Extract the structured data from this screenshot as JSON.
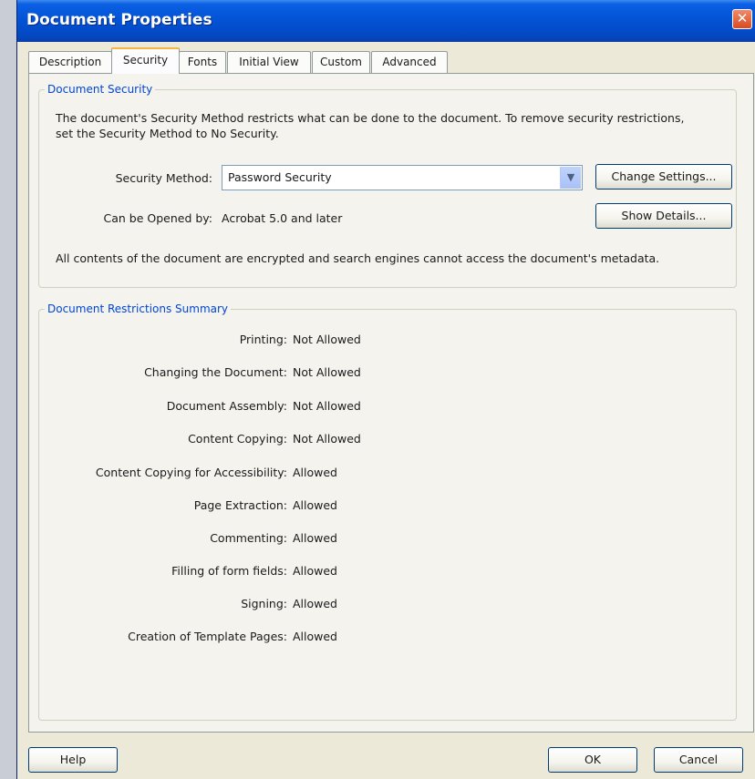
{
  "window": {
    "title": "Document Properties",
    "close_glyph": "✕"
  },
  "tabs": [
    "Description",
    "Security",
    "Fonts",
    "Initial View",
    "Custom",
    "Advanced"
  ],
  "active_tab": "Security",
  "document_security": {
    "group_title": "Document Security",
    "intro_text": "The document's Security Method restricts what can be done to the document. To remove security restrictions, set the Security Method to No Security.",
    "security_method_label": "Security Method:",
    "security_method_value": "Password Security",
    "change_settings_label": "Change Settings...",
    "opened_by_label": "Can be Opened by:",
    "opened_by_value": "Acrobat 5.0 and later",
    "show_details_label": "Show Details...",
    "encryption_note": "All contents of the document are encrypted and search engines cannot access the document's metadata."
  },
  "restrictions": {
    "group_title": "Document Restrictions Summary",
    "items": [
      {
        "label": "Printing:",
        "value": "Not Allowed"
      },
      {
        "label": "Changing the Document:",
        "value": "Not Allowed"
      },
      {
        "label": "Document Assembly:",
        "value": "Not Allowed"
      },
      {
        "label": "Content Copying:",
        "value": "Not Allowed"
      },
      {
        "label": "Content Copying for Accessibility:",
        "value": "Allowed"
      },
      {
        "label": "Page Extraction:",
        "value": "Allowed"
      },
      {
        "label": "Commenting:",
        "value": "Allowed"
      },
      {
        "label": "Filling of form fields:",
        "value": "Allowed"
      },
      {
        "label": "Signing:",
        "value": "Allowed"
      },
      {
        "label": "Creation of Template Pages:",
        "value": "Allowed"
      }
    ]
  },
  "footer": {
    "help_label": "Help",
    "ok_label": "OK",
    "cancel_label": "Cancel"
  },
  "colors": {
    "titlebar": "#0352d4",
    "group_title": "#0046d5",
    "active_tab_accent": "#f5b53f",
    "close_button": "#d84a22"
  },
  "icons": {
    "close": "close-icon",
    "dropdown": "chevron-down-icon"
  }
}
